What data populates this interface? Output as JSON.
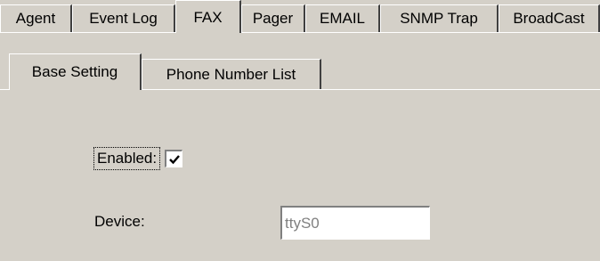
{
  "outer_tabs": [
    "Agent",
    "Event Log",
    "FAX",
    "Pager",
    "EMAIL",
    "SNMP Trap",
    "BroadCast"
  ],
  "outer_active": "FAX",
  "inner_tabs": [
    "Base Setting",
    "Phone Number List"
  ],
  "inner_active": "Base Setting",
  "form": {
    "enabled_label": "Enabled:",
    "enabled_checked": true,
    "device_label": "Device:",
    "device_value": "ttyS0"
  },
  "colors": {
    "face": "#d4d0c8",
    "highlight": "#ffffff",
    "shadow": "#404040",
    "disabled_text": "#808080"
  }
}
